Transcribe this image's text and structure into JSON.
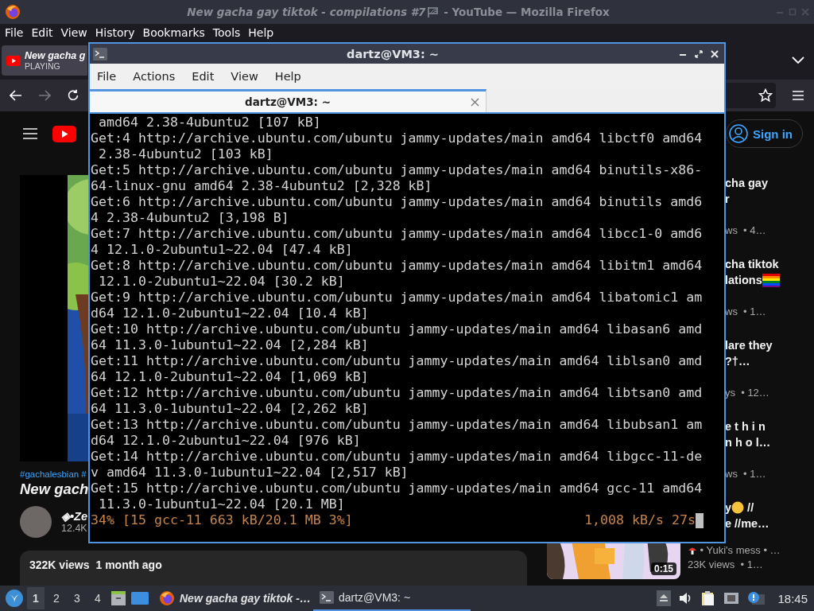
{
  "browser": {
    "title_start": "New gacha gay tiktok - compilations #7",
    "title_end": " - YouTube — Mozilla Firefox",
    "menu": [
      "File",
      "Edit",
      "View",
      "History",
      "Bookmarks",
      "Tools",
      "Help"
    ],
    "tab": {
      "title": "New gacha g",
      "status": "PLAYING",
      "selected": true
    }
  },
  "youtube": {
    "sign_in": "Sign in",
    "video": {
      "hashtags": "#gachalesbian #",
      "title": "New gach",
      "channel": "◈•Ze",
      "subscribers": "12.4K",
      "views": "322K views",
      "age": "1 month ago"
    },
    "recommendations": [
      {
        "title_lines": [
          [
            {
              "kind": "text",
              "text": "cha gay"
            }
          ],
          [
            {
              "kind": "text",
              "text": "r"
            }
          ]
        ],
        "meta": "ws  • 4…"
      },
      {
        "title_lines": [
          [
            {
              "kind": "text",
              "text": "cha tiktok"
            }
          ],
          [
            {
              "kind": "text",
              "text": "lations"
            },
            {
              "kind": "flag"
            }
          ]
        ],
        "meta": "ws  • 1…"
      },
      {
        "title_lines": [
          [
            {
              "kind": "text",
              "text": "lare they"
            }
          ],
          [
            {
              "kind": "text",
              "text": "?†…"
            }
          ]
        ],
        "meta": "ys  • 12…"
      },
      {
        "title_lines": [
          [
            {
              "kind": "text",
              "text": "e t h i n"
            }
          ],
          [
            {
              "kind": "text",
              "text": "n h o l…"
            }
          ]
        ],
        "meta": "ws  • 1…"
      },
      {
        "title_lines": [
          [
            {
              "kind": "text",
              "text": "y"
            },
            {
              "kind": "emoji"
            },
            {
              "kind": "text",
              "text": " //"
            }
          ],
          [
            {
              "kind": "text",
              "text": "e //me…"
            }
          ]
        ],
        "channel": [
          {
            "kind": "mushroom"
          },
          {
            "kind": "text",
            "text": " • Yuki's mess • …"
          }
        ],
        "meta": "23K views  • 1…",
        "thumbnail": {
          "kind": "picture",
          "duration": "0:15"
        }
      }
    ]
  },
  "terminal": {
    "title": "dartz@VM3: ~",
    "menu": [
      "File",
      "Actions",
      "Edit",
      "View",
      "Help"
    ],
    "tabs": [
      {
        "title": "dartz@VM3: ~",
        "selected": true
      }
    ],
    "lines": [
      " amd64 2.38-4ubuntu2 [107 kB]",
      "Get:4 http://archive.ubuntu.com/ubuntu jammy-updates/main amd64 libctf0 amd64",
      " 2.38-4ubuntu2 [103 kB]",
      "Get:5 http://archive.ubuntu.com/ubuntu jammy-updates/main amd64 binutils-x86-",
      "64-linux-gnu amd64 2.38-4ubuntu2 [2,328 kB]",
      "Get:6 http://archive.ubuntu.com/ubuntu jammy-updates/main amd64 binutils amd6",
      "4 2.38-4ubuntu2 [3,198 B]",
      "Get:7 http://archive.ubuntu.com/ubuntu jammy-updates/main amd64 libcc1-0 amd6",
      "4 12.1.0-2ubuntu1~22.04 [47.4 kB]",
      "Get:8 http://archive.ubuntu.com/ubuntu jammy-updates/main amd64 libitm1 amd64",
      " 12.1.0-2ubuntu1~22.04 [30.2 kB]",
      "Get:9 http://archive.ubuntu.com/ubuntu jammy-updates/main amd64 libatomic1 am",
      "d64 12.1.0-2ubuntu1~22.04 [10.4 kB]",
      "Get:10 http://archive.ubuntu.com/ubuntu jammy-updates/main amd64 libasan6 amd",
      "64 11.3.0-1ubuntu1~22.04 [2,284 kB]",
      "Get:11 http://archive.ubuntu.com/ubuntu jammy-updates/main amd64 liblsan0 amd",
      "64 12.1.0-2ubuntu1~22.04 [1,069 kB]",
      "Get:12 http://archive.ubuntu.com/ubuntu jammy-updates/main amd64 libtsan0 amd",
      "64 11.3.0-1ubuntu1~22.04 [2,262 kB]",
      "Get:13 http://archive.ubuntu.com/ubuntu jammy-updates/main amd64 libubsan1 am",
      "d64 12.1.0-2ubuntu1~22.04 [976 kB]",
      "Get:14 http://archive.ubuntu.com/ubuntu jammy-updates/main amd64 libgcc-11-de",
      "v amd64 11.3.0-1ubuntu1~22.04 [2,517 kB]",
      "Get:15 http://archive.ubuntu.com/ubuntu jammy-updates/main amd64 gcc-11 amd64",
      " 11.3.0-1ubuntu1~22.04 [20.1 MB]"
    ],
    "progress": {
      "left": "34% [15 gcc-11 663 kB/20.1 MB 3%]",
      "right": "1,008 kB/s 27s"
    }
  },
  "taskbar": {
    "workspaces": [
      {
        "label": "1",
        "selected": true
      },
      {
        "label": "2",
        "selected": false
      },
      {
        "label": "3",
        "selected": false
      },
      {
        "label": "4",
        "selected": false
      }
    ],
    "tasks": [
      {
        "kind": "browser",
        "title": "New gacha gay tiktok -…",
        "selected": false
      },
      {
        "kind": "terminal",
        "title": "dartz@VM3: ~",
        "selected": true
      }
    ],
    "clock": "18:45"
  }
}
